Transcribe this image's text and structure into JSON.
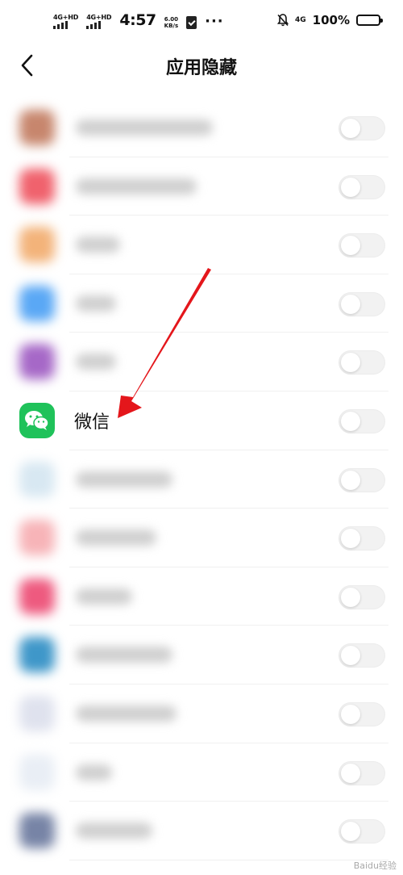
{
  "status_bar": {
    "signal1": "4G+HD",
    "signal2": "4G+HD",
    "time": "4:57",
    "speed_value": "6.00",
    "speed_unit": "KB/s",
    "more": "···",
    "net": "4G",
    "battery_pct": "100%"
  },
  "header": {
    "title": "应用隐藏"
  },
  "apps": [
    {
      "name": "",
      "icon_color": "#c7866d",
      "blurred": true,
      "enabled": false
    },
    {
      "name": "",
      "icon_color": "#f0626d",
      "blurred": true,
      "enabled": false
    },
    {
      "name": "",
      "icon_color": "#f3b37a",
      "blurred": true,
      "enabled": false
    },
    {
      "name": "",
      "icon_color": "#5aa8f5",
      "blurred": true,
      "enabled": false
    },
    {
      "name": "",
      "icon_color": "#a668c7",
      "blurred": true,
      "enabled": false
    },
    {
      "name": "微信",
      "icon_color": "#1fc25a",
      "blurred": false,
      "enabled": false
    },
    {
      "name": "",
      "icon_color": "#d8e8f2",
      "blurred": true,
      "enabled": false
    },
    {
      "name": "",
      "icon_color": "#f7b4b8",
      "blurred": true,
      "enabled": false
    },
    {
      "name": "",
      "icon_color": "#ee5a7f",
      "blurred": true,
      "enabled": false
    },
    {
      "name": "",
      "icon_color": "#3f97c9",
      "blurred": true,
      "enabled": false
    },
    {
      "name": "",
      "icon_color": "#dfe2ee",
      "blurred": true,
      "enabled": false
    },
    {
      "name": "",
      "icon_color": "#e9eef5",
      "blurred": true,
      "enabled": false
    },
    {
      "name": "",
      "icon_color": "#7784a6",
      "blurred": true,
      "enabled": false
    }
  ],
  "colors": {
    "arrow": "#e4161b",
    "toggle_off": "#f2f2f2"
  },
  "icons": {
    "back": "back-chevron-icon",
    "wechat": "wechat-icon"
  },
  "watermark": "Baidu经验"
}
